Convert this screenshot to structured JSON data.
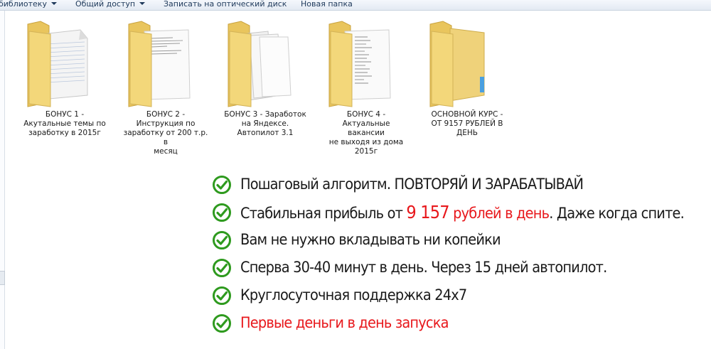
{
  "toolbar": {
    "items": [
      {
        "label": "библиотеку",
        "dropdown": true
      },
      {
        "label": "Общий доступ",
        "dropdown": true
      },
      {
        "label": "Записать на оптический диск",
        "dropdown": false
      },
      {
        "label": "Новая папка",
        "dropdown": false
      }
    ]
  },
  "files": [
    {
      "line1": "БОНУС 1 -",
      "line2": "Акутальные темы по",
      "line3": "заработку в 2015г",
      "line4": "",
      "icon": "folder-lined-paper-icon"
    },
    {
      "line1": "БОНУС 2 -",
      "line2": "Инструкция по",
      "line3": "заработку от 200 т.р. в",
      "line4": "месяц",
      "icon": "folder-document-icon"
    },
    {
      "line1": "БОНУС 3 - Заработок",
      "line2": "на Яндексе.",
      "line3": "Автопилот 3.1",
      "line4": "",
      "icon": "folder-papers-icon"
    },
    {
      "line1": "БОНУС 4 -",
      "line2": "Актуальные вакансии",
      "line3": "не выходя из дома",
      "line4": "2015г",
      "icon": "folder-list-icon"
    },
    {
      "line1": "ОСНОВНОЙ КУРС -",
      "line2": "ОТ 9157 РУБЛЕЙ В",
      "line3": "ДЕНЬ",
      "line4": "",
      "icon": "folder-icon"
    }
  ],
  "features": [
    {
      "a": "Пошаговый алгоритм. ",
      "b": "ПОВТОРЯЙ И ЗАРАБАТЫВАЙ"
    },
    {
      "a": "Стабильная прибыль от ",
      "num": "9 157",
      "red": " рублей в день",
      "c": ". Даже когда спите."
    },
    {
      "a": "Вам не нужно вкладывать ни копейки"
    },
    {
      "a": "Сперва 30-40 минут в день. Через 15 дней автопилот."
    },
    {
      "a": "Круглосуточная поддержка 24x7"
    },
    {
      "red": "Первые деньги в день запуска"
    }
  ],
  "colors": {
    "accent_red": "#e8181c",
    "check_green": "#2e9a1e",
    "folder_yellow": "#f3d77a",
    "toolbar_text": "#1e395b"
  }
}
